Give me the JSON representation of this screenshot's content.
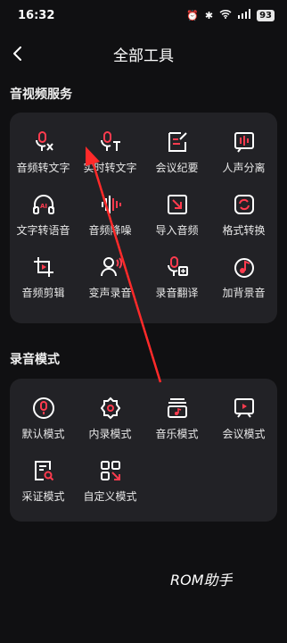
{
  "status": {
    "time": "16:32",
    "battery": "93"
  },
  "header": {
    "title": "全部工具"
  },
  "sections": [
    {
      "title": "音视频服务",
      "items": [
        {
          "label": "音频转文字",
          "icon": "audio-to-text-icon"
        },
        {
          "label": "实时转文字",
          "icon": "realtime-transcribe-icon"
        },
        {
          "label": "会议纪要",
          "icon": "meeting-notes-icon"
        },
        {
          "label": "人声分离",
          "icon": "vocal-separation-icon"
        },
        {
          "label": "文字转语音",
          "icon": "text-to-speech-icon"
        },
        {
          "label": "音频降噪",
          "icon": "noise-reduction-icon"
        },
        {
          "label": "导入音频",
          "icon": "import-audio-icon"
        },
        {
          "label": "格式转换",
          "icon": "format-convert-icon"
        },
        {
          "label": "音频剪辑",
          "icon": "audio-clip-icon"
        },
        {
          "label": "变声录音",
          "icon": "voice-change-icon"
        },
        {
          "label": "录音翻译",
          "icon": "recording-translate-icon"
        },
        {
          "label": "加背景音",
          "icon": "background-music-icon"
        }
      ]
    },
    {
      "title": "录音模式",
      "items": [
        {
          "label": "默认模式",
          "icon": "default-mode-icon"
        },
        {
          "label": "内录模式",
          "icon": "internal-record-icon"
        },
        {
          "label": "音乐模式",
          "icon": "music-mode-icon"
        },
        {
          "label": "会议模式",
          "icon": "meeting-mode-icon"
        },
        {
          "label": "采证模式",
          "icon": "evidence-mode-icon"
        },
        {
          "label": "自定义模式",
          "icon": "custom-mode-icon"
        }
      ]
    }
  ],
  "watermark": "ROM助手",
  "colors": {
    "accent": "#ff3b4e",
    "background": "#101012",
    "panel": "#222226"
  }
}
